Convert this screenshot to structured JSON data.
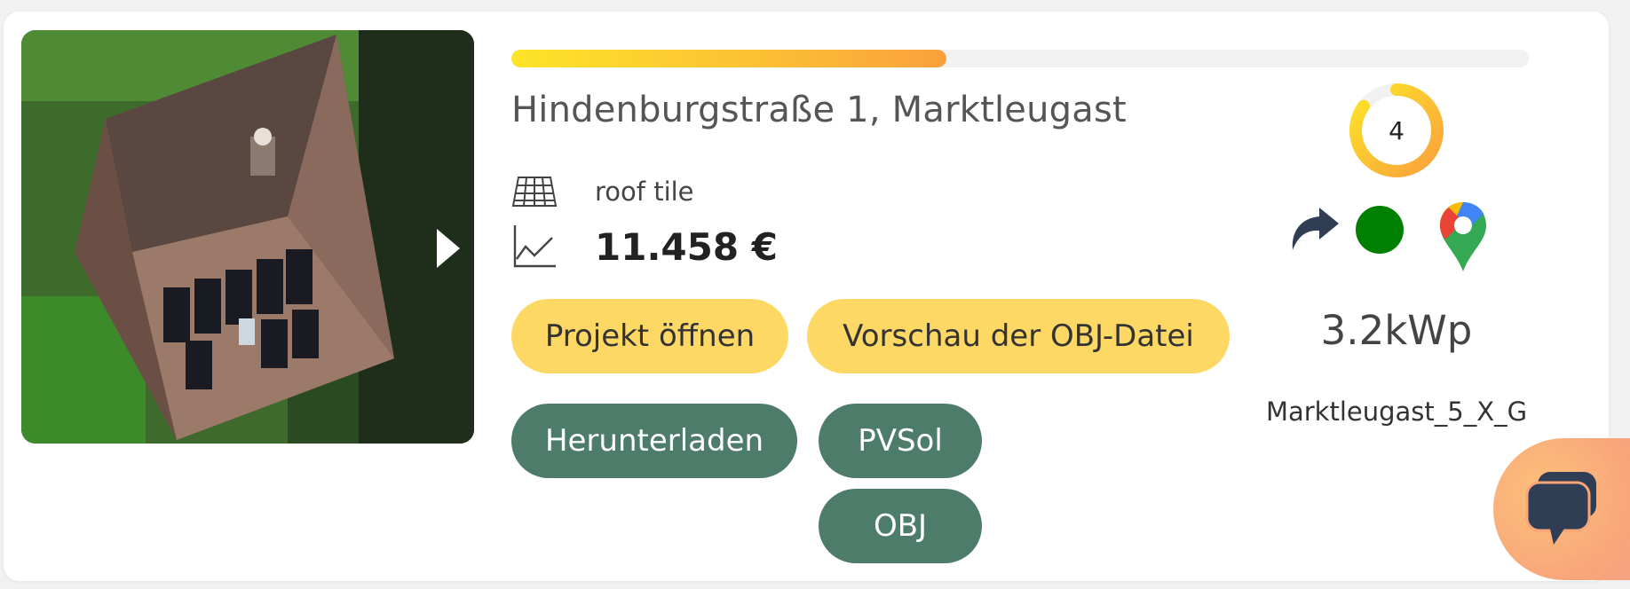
{
  "project_card": {
    "address": "Hindenburgstraße 1, Marktleugast",
    "progress_fraction": 0.428,
    "roof_type": "roof tile",
    "price": "11.458 €",
    "score": "4",
    "score_fraction": 0.85,
    "capacity": "3.2kWp",
    "project_code": "Marktleugast_5_X_G",
    "status_color": "#008000",
    "buttons": {
      "open_project": "Projekt öffnen",
      "preview_obj": "Vorschau der OBJ-Datei",
      "download": "Herunterladen",
      "pvsol": "PVSol",
      "obj": "OBJ"
    },
    "icons": {
      "roof": "roof-tile-icon",
      "price": "line-chart-icon",
      "share": "share-arrow-icon",
      "maps": "google-maps-pin-icon",
      "next": "chevron-right-icon",
      "chat": "chat-bubbles-icon"
    },
    "colors": {
      "progress_start": "#fde428",
      "progress_end": "#f9a13c",
      "yellow_button": "#fed865",
      "green_button": "#4d7d6a",
      "chat_bubble": "#f9a57a"
    }
  }
}
